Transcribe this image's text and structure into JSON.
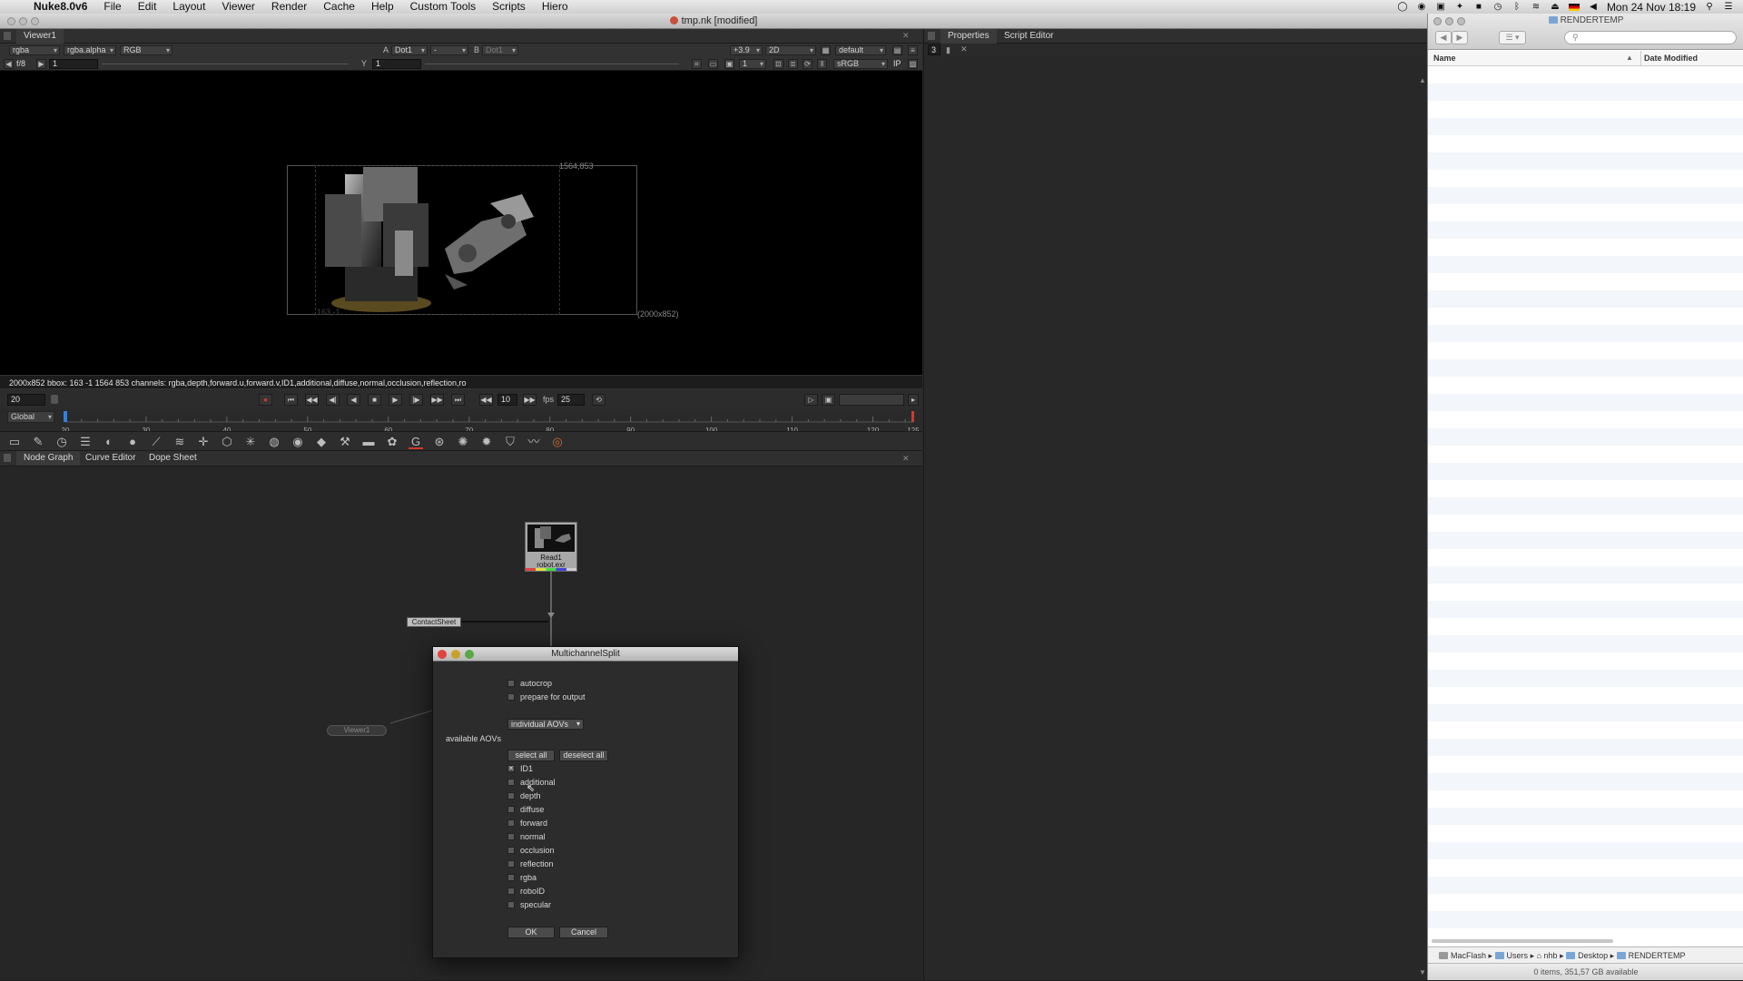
{
  "menubar": {
    "app_name": "Nuke8.0v6",
    "items": [
      "File",
      "Edit",
      "Layout",
      "Viewer",
      "Render",
      "Cache",
      "Help",
      "Custom Tools",
      "Scripts",
      "Hiero"
    ],
    "clock": "Mon 24 Nov  18:19"
  },
  "window": {
    "title": "tmp.nk [modified]"
  },
  "viewer": {
    "tab_label": "Viewer1",
    "channels": "rgba",
    "alpha_channel": "rgba.alpha",
    "display_channel": "RGB",
    "a_label": "A",
    "a_input": "Dot1",
    "wipe_mode": "-",
    "b_label": "B",
    "b_input": "Dot1",
    "zoom": "+3.9",
    "view_mode": "2D",
    "lut_default": "default",
    "fstop": "f/8",
    "gain_value": "1",
    "gamma_label": "Y",
    "gamma_value": "1",
    "proxy_value": "1",
    "colorspace": "sRGB",
    "ip_label": "IP",
    "bbox_size_label": "1564,853",
    "format_label": "(2000x852)",
    "origin_label": "163,-1",
    "info_bar": "2000x852  bbox: 163 -1 1564 853 channels: rgba,depth,forward.u,forward.v,ID1,additional,diffuse,normal,occlusion,reflection,ro"
  },
  "transport": {
    "frame": "20",
    "increment": "10",
    "fps_label": "fps",
    "fps": "25",
    "range_mode": "Global",
    "frame_current": 20,
    "frame_end": 125,
    "ticks": [
      "20",
      "30",
      "40",
      "50",
      "60",
      "70",
      "80",
      "90",
      "100",
      "110",
      "120",
      "125"
    ]
  },
  "nodegraph": {
    "tabs": [
      "Node Graph",
      "Curve Editor",
      "Dope Sheet"
    ],
    "read_node_name": "Read1",
    "read_node_file": "robot.exr",
    "contact_node_name": "ContactSheet",
    "viewer_node_name": "Viewer1"
  },
  "right_pane": {
    "tabs": [
      "Properties",
      "Script Editor"
    ],
    "max_panels": "3"
  },
  "dialog": {
    "title": "MultichannelSplit",
    "autocrop_label": "autocrop",
    "prepare_label": "prepare for output",
    "mode_value": "individual AOVs",
    "available_label": "available AOVs",
    "select_all_label": "select all",
    "deselect_all_label": "deselect all",
    "aovs": [
      {
        "name": "ID1",
        "checked": true
      },
      {
        "name": "additional",
        "checked": false
      },
      {
        "name": "depth",
        "checked": false
      },
      {
        "name": "diffuse",
        "checked": false
      },
      {
        "name": "forward",
        "checked": false
      },
      {
        "name": "normal",
        "checked": false
      },
      {
        "name": "occlusion",
        "checked": false
      },
      {
        "name": "reflection",
        "checked": false
      },
      {
        "name": "rgba",
        "checked": false
      },
      {
        "name": "roboID",
        "checked": false
      },
      {
        "name": "specular",
        "checked": false
      }
    ],
    "ok_label": "OK",
    "cancel_label": "Cancel"
  },
  "finder": {
    "title": "RENDERTEMP",
    "col_name": "Name",
    "col_date": "Date Modified",
    "path": [
      "MacFlash",
      "Users",
      "nhb",
      "Desktop",
      "RENDERTEMP"
    ],
    "status": "0 items, 351,57 GB available"
  },
  "colors": {
    "accent_red": "#d03a2a",
    "playhead": "#3a7fd0",
    "ui_dark": "#282828"
  }
}
